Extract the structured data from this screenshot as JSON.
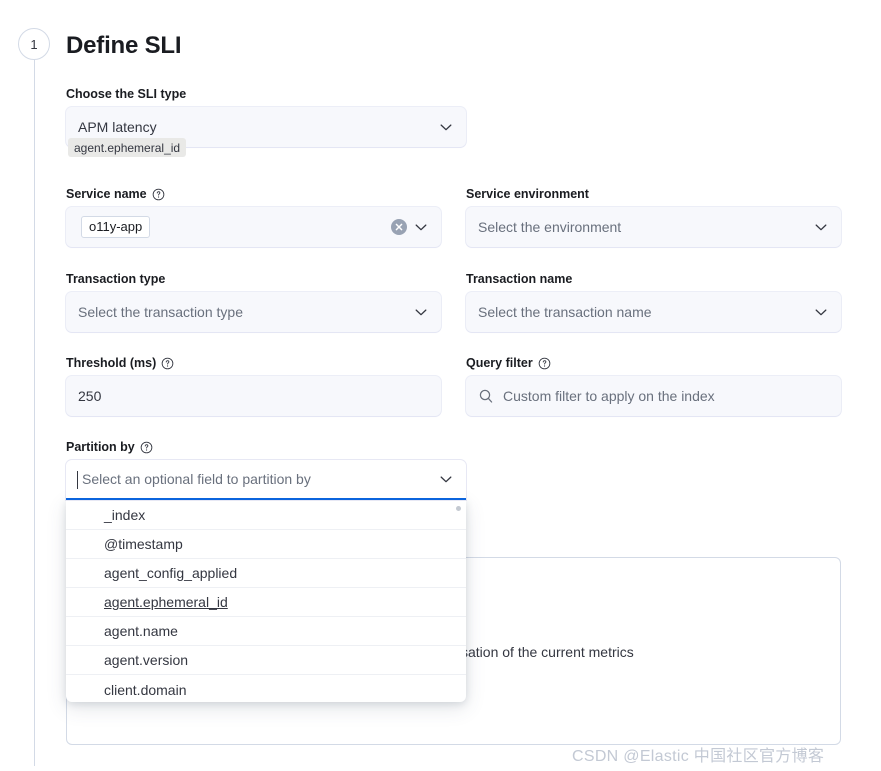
{
  "step": {
    "number": "1",
    "title": "Define SLI"
  },
  "fields": {
    "sli_type": {
      "label": "Choose the SLI type",
      "value": "APM latency",
      "caret_icon": "chevron-down-icon"
    },
    "service_name": {
      "label": "Service name",
      "help_icon": "question-circle-icon",
      "pill_value": "o11y-app",
      "clear_icon": "clear-circle-icon",
      "caret_icon": "chevron-down-icon"
    },
    "service_environment": {
      "label": "Service environment",
      "placeholder": "Select the environment",
      "caret_icon": "chevron-down-icon"
    },
    "transaction_type": {
      "label": "Transaction type",
      "placeholder": "Select the transaction type",
      "caret_icon": "chevron-down-icon"
    },
    "transaction_name": {
      "label": "Transaction name",
      "placeholder": "Select the transaction name",
      "caret_icon": "chevron-down-icon"
    },
    "threshold": {
      "label": "Threshold (ms)",
      "help_icon": "question-circle-icon",
      "value": "250"
    },
    "query_filter": {
      "label": "Query filter",
      "help_icon": "question-circle-icon",
      "placeholder": "Custom filter to apply on the index",
      "search_icon": "search-icon"
    },
    "partition_by": {
      "label": "Partition by",
      "help_icon": "question-circle-icon",
      "placeholder": "Select an optional field to partition by",
      "caret_icon": "chevron-down-icon"
    }
  },
  "dropdown": {
    "options": [
      {
        "label": "_index",
        "hovered": false
      },
      {
        "label": "@timestamp",
        "hovered": false
      },
      {
        "label": "agent_config_applied",
        "hovered": false
      },
      {
        "label": "agent.ephemeral_id",
        "hovered": true
      },
      {
        "label": "agent.name",
        "hovered": false
      },
      {
        "label": "agent.version",
        "hovered": false
      },
      {
        "label": "client.domain",
        "hovered": false
      }
    ]
  },
  "tooltip": {
    "text": "agent.ephemeral_id"
  },
  "preview": {
    "text": "alisation of the current metrics"
  },
  "watermark": {
    "text": "CSDN @Elastic 中国社区官方博客"
  },
  "colors": {
    "accent": "#0b64dd",
    "border": "#d3dae6",
    "field_bg": "#f7f8fc",
    "text": "#343741",
    "text_strong": "#1a1c21",
    "placeholder": "#69707d"
  }
}
